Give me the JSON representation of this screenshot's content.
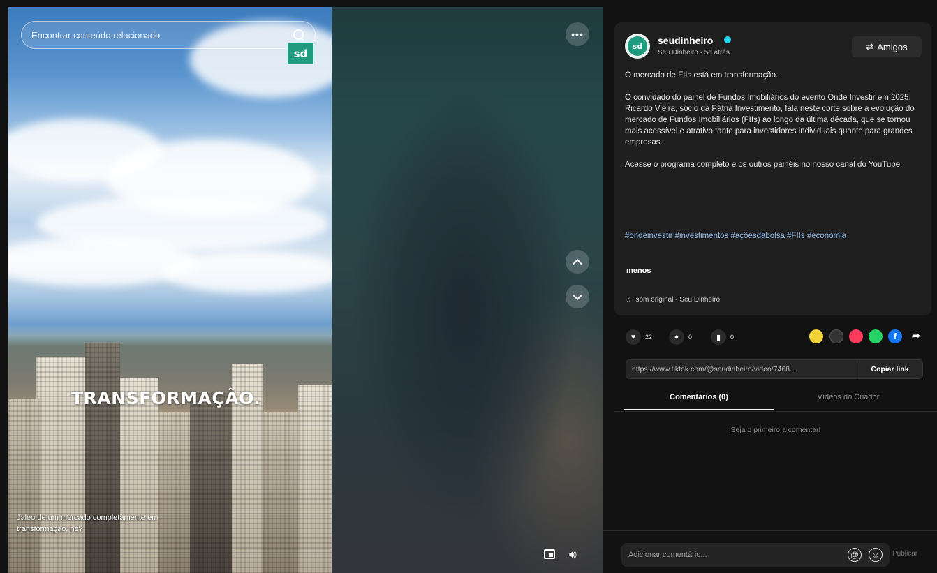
{
  "video": {
    "search_placeholder": "Encontrar conteúdo relacionado",
    "brand_logo": "sd",
    "overlay_title": "TRANSFORMAÇÃO.",
    "caption": "Jaleo de um mercado completamente em transformação, né?"
  },
  "controls": {
    "more_label": "•••"
  },
  "post": {
    "avatar_initials": "sd",
    "username": "seudinheiro",
    "subline": "Seu Dinheiro · 5d atrás",
    "friends_label": "Amigos",
    "description": [
      "O mercado de FIIs está em transformação.",
      "O convidado do painel de Fundos Imobiliários do evento Onde Investir em 2025, Ricardo Vieira, sócio da Pátria Investimento, fala neste corte sobre a evolução do mercado de Fundos Imobiliários (FIIs) ao longo da última década, que se tornou mais acessível e atrativo tanto para investidores individuais quanto para grandes empresas.",
      "Acesse o programa completo e os outros painéis no nosso canal do YouTube."
    ],
    "hashtags": "#ondeinvestir #investimentos #açõesdabolsa #FIIs #economia",
    "less_label": "menos",
    "sound": "som original - Seu Dinheiro"
  },
  "actions": {
    "likes": "22",
    "comments": "0",
    "saves": "0"
  },
  "link": {
    "url": "https://www.tiktok.com/@seudinheiro/video/7468...",
    "copy_label": "Copiar link"
  },
  "tabs": {
    "comments": "Comentários (0)",
    "creator_videos": "Vídeos do Criador"
  },
  "comments": {
    "empty_text": "Seja o primeiro a comentar!",
    "input_placeholder": "Adicionar comentário...",
    "post_label": "Publicar"
  },
  "colors": {
    "background": "#121212",
    "card": "#1f1f1f",
    "hashtag": "#8fb6e8",
    "verified": "#20d5ec",
    "brand": "#1f9b7f"
  }
}
